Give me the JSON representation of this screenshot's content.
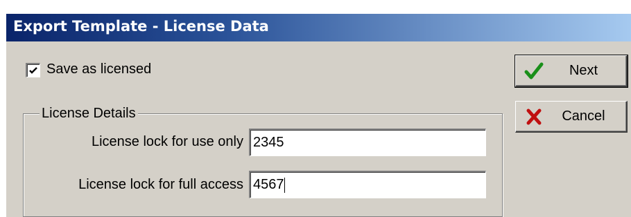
{
  "window": {
    "title": "Export Template - License Data"
  },
  "options": {
    "save_as_licensed_label": "Save as licensed",
    "save_as_licensed_checked": true
  },
  "license_details": {
    "legend": "License Details",
    "use_only": {
      "label": "License lock for use only",
      "value": "2345"
    },
    "full_access": {
      "label": "License lock for full access",
      "value": "4567"
    }
  },
  "buttons": {
    "next": {
      "label": "Next",
      "icon": "checkmark-icon",
      "color": "#1a8f1a"
    },
    "cancel": {
      "label": "Cancel",
      "icon": "x-icon",
      "color": "#c01010"
    }
  }
}
